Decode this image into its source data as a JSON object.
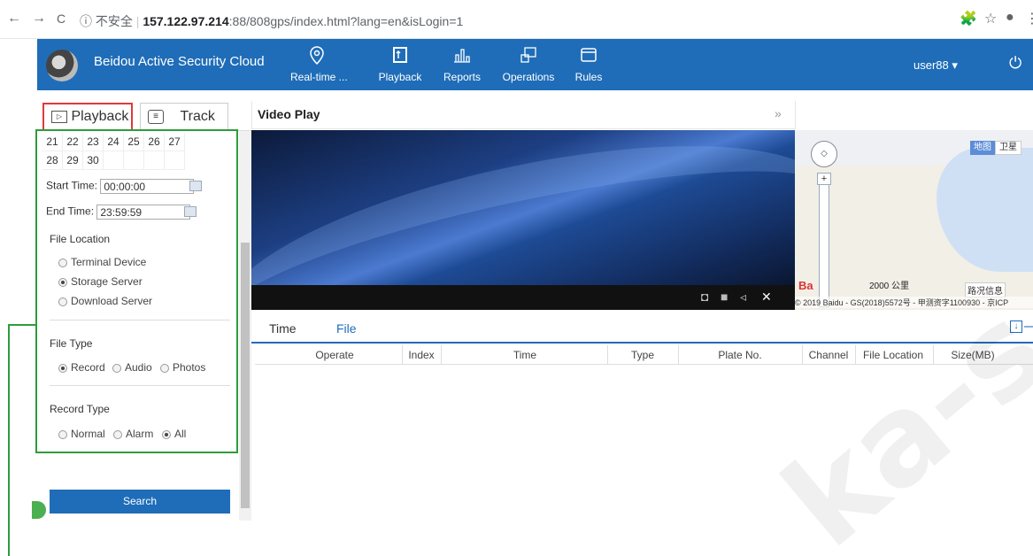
{
  "browser": {
    "back": "←",
    "forward": "→",
    "reload": "C",
    "security": "ⓘ 不安全",
    "host": "157.122.97.214",
    "path": ":88/808gps/index.html?lang=en&isLogin=1"
  },
  "header": {
    "title": "Beidou Active Security Cloud",
    "nav": [
      {
        "label": "Real-time ..."
      },
      {
        "label": "Playback"
      },
      {
        "label": "Reports"
      },
      {
        "label": "Operations"
      },
      {
        "label": "Rules"
      }
    ],
    "user": "user88 ▾"
  },
  "left": {
    "tab_playback": "Playback",
    "tab_track": "Track",
    "calendar_rows": [
      [
        "21",
        "22",
        "23",
        "24",
        "25",
        "26",
        "27"
      ],
      [
        "28",
        "29",
        "30",
        "",
        "",
        "",
        ""
      ]
    ],
    "start_time_label": "Start Time:",
    "start_time_value": "00:00:00",
    "end_time_label": "End Time:",
    "end_time_value": "23:59:59",
    "file_location_label": "File Location",
    "file_location_options": [
      "Terminal Device",
      "Storage Server",
      "Download Server"
    ],
    "file_type_label": "File Type",
    "file_type_options": [
      "Record",
      "Audio",
      "Photos"
    ],
    "record_type_label": "Record Type",
    "record_type_options": [
      "Normal",
      "Alarm",
      "All"
    ],
    "search_label": "Search"
  },
  "video": {
    "title": "Video Play"
  },
  "map": {
    "type_map": "地图",
    "type_satellite": "卫星",
    "scale": "2000 公里",
    "traffic": "路况信息",
    "copyright": "© 2019 Baidu - GS(2018)5572号 - 甲测资字1100930 - 京ICP"
  },
  "bottom": {
    "tab_time": "Time",
    "tab_file": "File",
    "columns": [
      "Operate",
      "Index",
      "Time",
      "Type",
      "Plate No.",
      "Channel",
      "File Location",
      "Size(MB)"
    ]
  },
  "watermark": "ka-s"
}
